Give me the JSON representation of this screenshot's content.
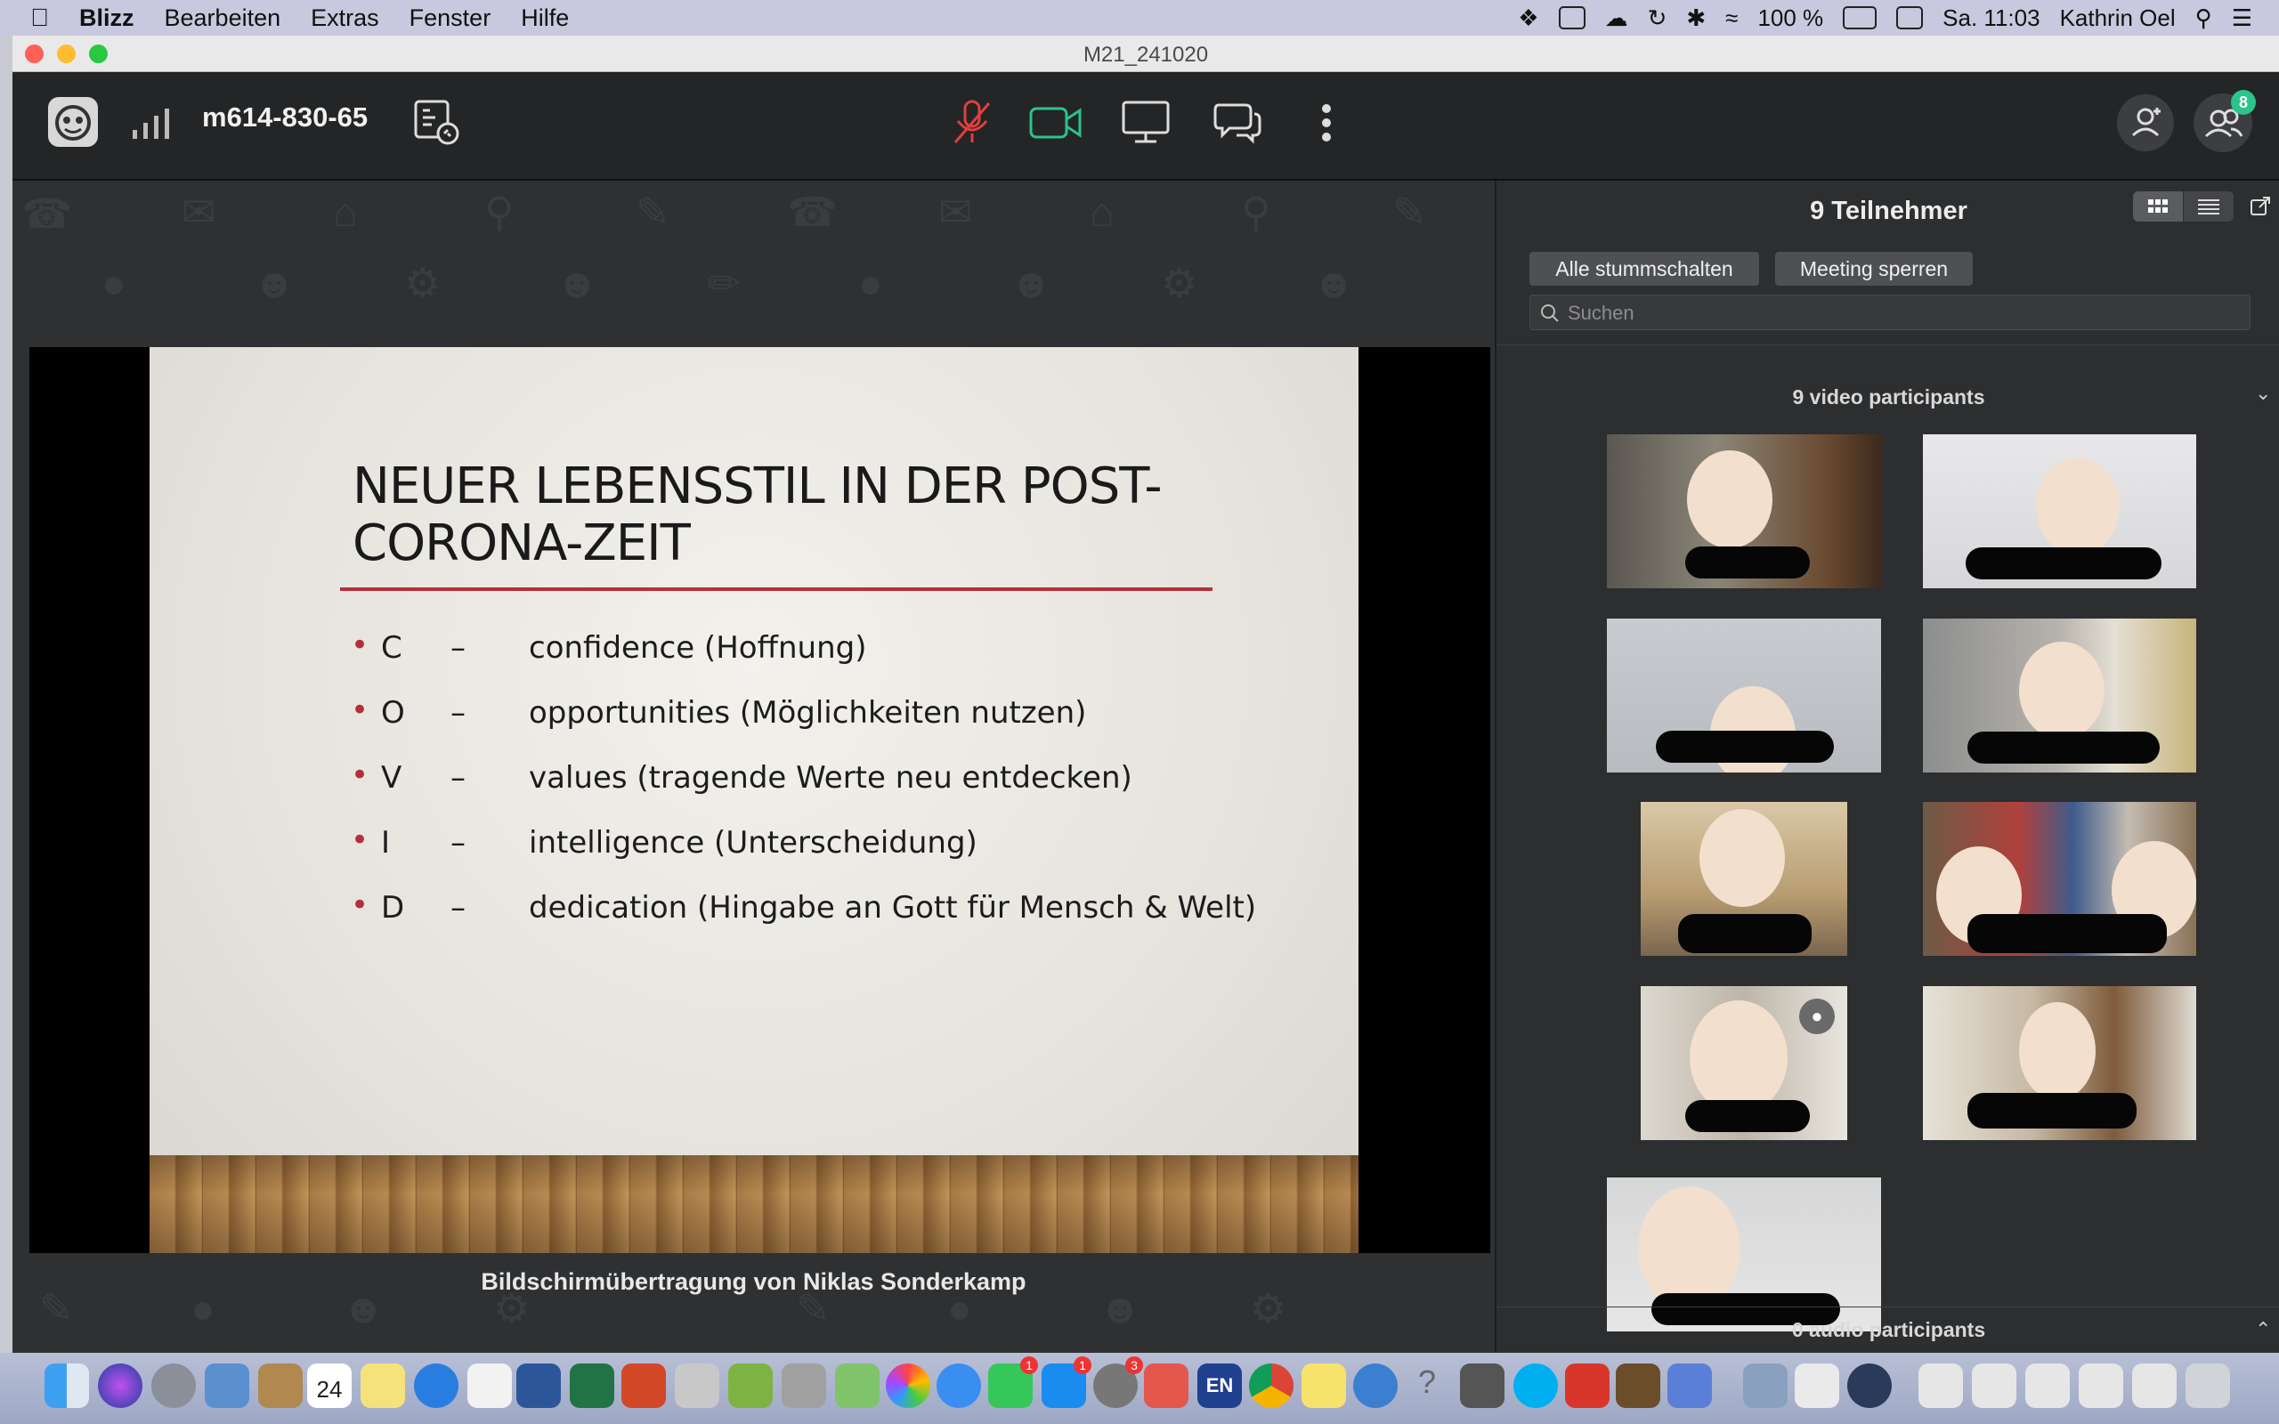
{
  "menubar": {
    "app_name": "Blizz",
    "items": [
      "Bearbeiten",
      "Extras",
      "Fenster",
      "Hilfe"
    ],
    "battery": "100 %",
    "clock": "Sa. 11:03",
    "user": "Kathrin Oel"
  },
  "window": {
    "title": "M21_241020"
  },
  "toolbar": {
    "meeting_id": "m614-830-65",
    "participant_badge": "8"
  },
  "slide": {
    "title": "NEUER LEBENSSTIL IN DER POST-CORONA-ZEIT",
    "bullets": [
      {
        "letter": "C",
        "dash": "–",
        "text": "confidence (Hoffnung)"
      },
      {
        "letter": "O",
        "dash": "–",
        "text": "opportunities (Möglichkeiten nutzen)"
      },
      {
        "letter": "V",
        "dash": "–",
        "text": "values (tragende Werte neu entdecken)"
      },
      {
        "letter": "I",
        "dash": "–",
        "text": "intelligence (Unterscheidung)"
      },
      {
        "letter": "D",
        "dash": "–",
        "text": "dedication (Hingabe an Gott für Mensch & Welt)"
      }
    ]
  },
  "stage": {
    "caption": "Bildschirmübertragung von Niklas Sonderkamp"
  },
  "panel": {
    "title": "9 Teilnehmer",
    "mute_all": "Alle stummschalten",
    "lock_meeting": "Meeting sperren",
    "search_placeholder": "Suchen",
    "video_header": "9 video participants",
    "audio_header": "0 audio participants"
  },
  "dock": {
    "calendar_day": "24",
    "lang": "EN",
    "notif_facetime": "1",
    "notif_appstore": "1",
    "notif_prefs": "3"
  },
  "colors": {
    "accent_red": "#b3303a",
    "video_green": "#2bc48a",
    "mic_red": "#e04040"
  }
}
